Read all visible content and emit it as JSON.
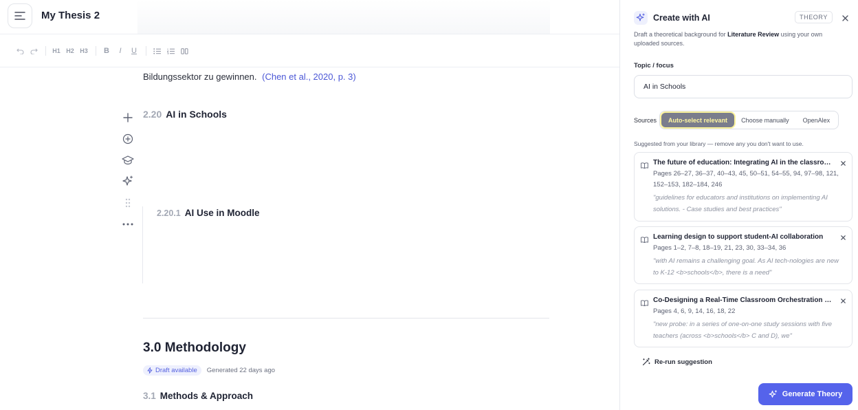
{
  "header": {
    "doc_title": "My Thesis 2"
  },
  "toolbar": {
    "h1": "H1",
    "h2": "H2",
    "h3": "H3",
    "bold": "B",
    "italic": "I",
    "underline": "U"
  },
  "editor": {
    "paragraph_text": "Bildungssektor zu gewinnen.",
    "citation": "(Chen et al., 2020, p. 3)",
    "section_2_20": {
      "num": "2.20",
      "title": "AI in Schools"
    },
    "section_2_20_1": {
      "num": "2.20.1",
      "title": "AI Use in Moodle"
    },
    "section_3_0": {
      "num": "3.0",
      "title": "Methodology"
    },
    "draft_badge": "Draft available",
    "generated": "Generated 22 days ago",
    "section_3_1": {
      "num": "3.1",
      "title": "Methods & Approach"
    }
  },
  "panel": {
    "title": "Create with AI",
    "badge": "THEORY",
    "desc_prefix": "Draft a theoretical background for ",
    "desc_bold": "Literature Review",
    "desc_suffix": " using your own uploaded sources.",
    "topic_label": "Topic / focus",
    "topic_value": "AI in Schools",
    "sources_label": "Sources",
    "source_options": [
      "Auto-select relevant",
      "Choose manually",
      "OpenAlex"
    ],
    "hint": "Suggested from your library — remove any you don't want to use.",
    "suggestions": [
      {
        "title": "The future of education: Integrating AI in the classroom",
        "pages": "Pages 26–27, 36–37, 40–43, 45, 50–51, 54–55, 94, 97–98, 121, 152–153, 182–184, 246",
        "quote": "\"guidelines for educators and institutions on implementing AI solutions. - Case studies and best practices\""
      },
      {
        "title": "Learning design to support student-AI collaboration",
        "pages": "Pages 1–2, 7–8, 18–19, 21, 23, 30, 33–34, 36",
        "quote": "\"with AI remains a challenging goal. As AI tech-nologies are new to K-12 <b>schools</b>, there is a need\""
      },
      {
        "title": "Co-Designing a Real-Time Classroom Orchestration Tool",
        "pages": "Pages 4, 6, 9, 14, 16, 18, 22",
        "quote": "\"new probe: in a series of one-on-one study sessions with five teachers (across <b>schools</b> C and D), we\""
      }
    ],
    "rerun": "Re-run suggestion",
    "generate": "Generate Theory"
  }
}
